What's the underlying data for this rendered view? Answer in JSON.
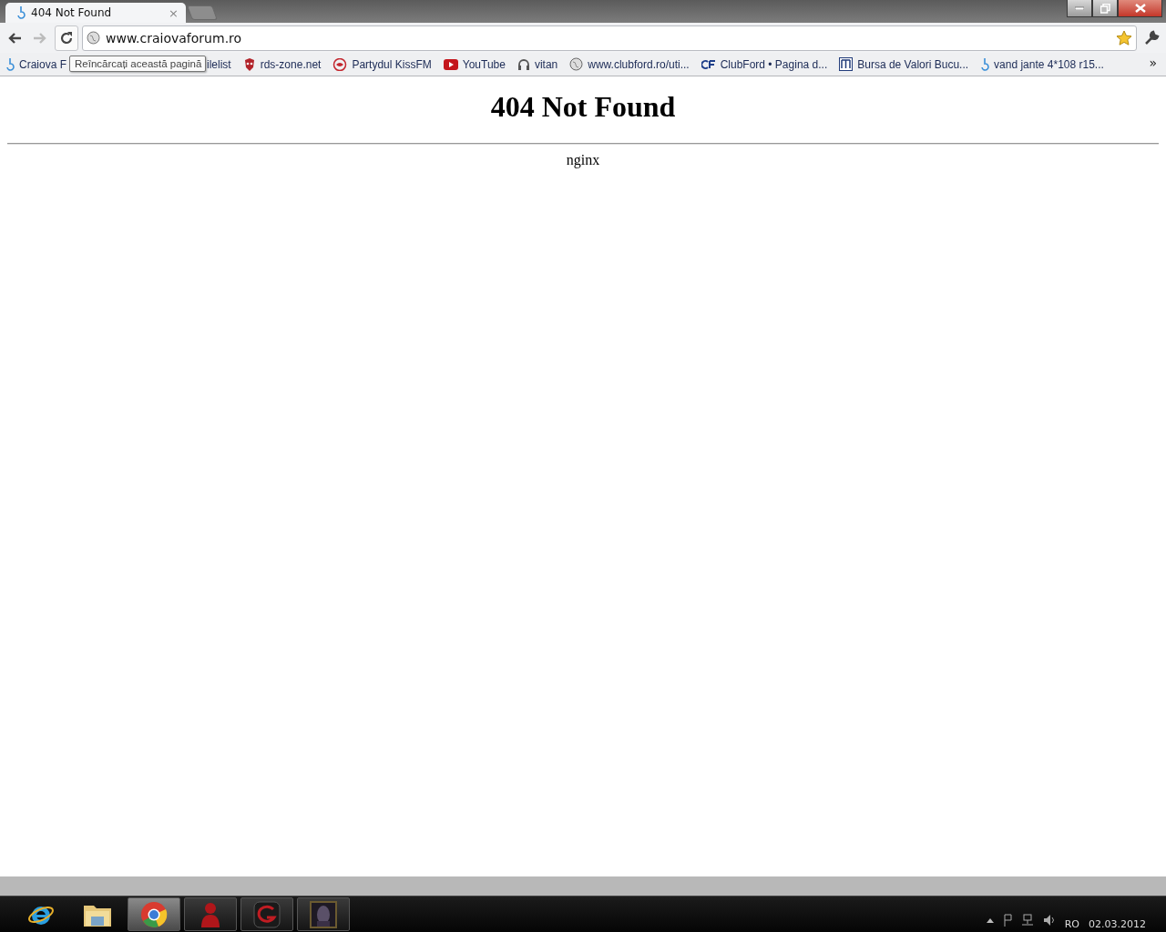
{
  "tabs": [
    {
      "title": "404 Not Found",
      "selected": true,
      "close": "×"
    }
  ],
  "toolbar": {
    "url": "www.craiovaforum.ro",
    "bookmarked": true
  },
  "bookmarks": [
    {
      "label": "Craiova F",
      "kind": "forum"
    },
    {
      "label": "ilelist",
      "kind": "none"
    },
    {
      "label": "rds-zone.net",
      "kind": "mask"
    },
    {
      "label": "Partydul KissFM",
      "kind": "kiss"
    },
    {
      "label": "YouTube",
      "kind": "youtube"
    },
    {
      "label": "vitan",
      "kind": "headphones"
    },
    {
      "label": "www.clubford.ro/uti...",
      "kind": "globe"
    },
    {
      "label": "ClubFord • Pagina d...",
      "kind": "cf"
    },
    {
      "label": "Bursa de Valori Bucu...",
      "kind": "bvb"
    },
    {
      "label": "vand jante 4*108 r15...",
      "kind": "forum"
    }
  ],
  "bookmarks_more": "»",
  "tooltip": "Reîncărcați această pagină",
  "page": {
    "heading": "404 Not Found",
    "server": "nginx"
  },
  "taskbar": {
    "items": [
      {
        "kind": "ie",
        "running": false,
        "selected": false
      },
      {
        "kind": "folder",
        "running": false,
        "selected": false
      },
      {
        "kind": "chrome",
        "running": true,
        "selected": true
      },
      {
        "kind": "red-figure",
        "running": true,
        "selected": false
      },
      {
        "kind": "garena",
        "running": true,
        "selected": false
      },
      {
        "kind": "portrait",
        "running": true,
        "selected": false
      }
    ],
    "language": "RO",
    "date": "02.03.2012"
  }
}
